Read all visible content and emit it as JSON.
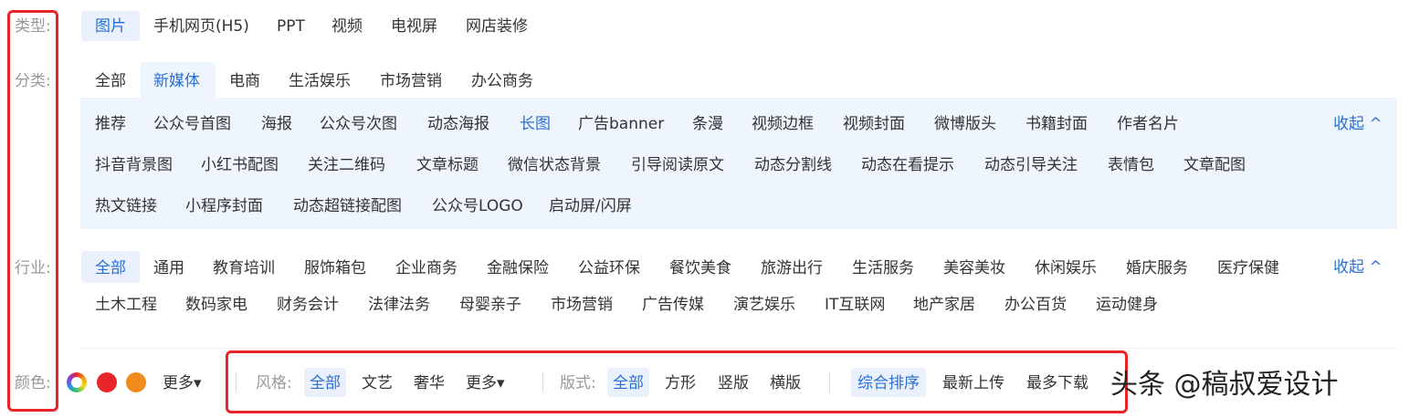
{
  "type_row": {
    "label": "类型:",
    "options": [
      "图片",
      "手机网页(H5)",
      "PPT",
      "视频",
      "电视屏",
      "网店装修"
    ]
  },
  "category_row": {
    "label": "分类:",
    "options": [
      "全部",
      "新媒体",
      "电商",
      "生活娱乐",
      "市场营销",
      "办公商务"
    ],
    "collapse_label": "收起 ^",
    "sub_rows": [
      [
        "推荐",
        "公众号首图",
        "海报",
        "公众号次图",
        "动态海报",
        "长图",
        "广告banner",
        "条漫",
        "视频边框",
        "视频封面",
        "微博版头",
        "书籍封面",
        "作者名片"
      ],
      [
        "抖音背景图",
        "小红书配图",
        "关注二维码",
        "文章标题",
        "微信状态背景",
        "引导阅读原文",
        "动态分割线",
        "动态在看提示",
        "动态引导关注",
        "表情包",
        "文章配图"
      ],
      [
        "热文链接",
        "小程序封面",
        "动态超链接配图",
        "公众号LOGO",
        "启动屏/闪屏"
      ]
    ]
  },
  "industry_row": {
    "label": "行业:",
    "collapse_label": "收起 ^",
    "rows": [
      [
        "全部",
        "通用",
        "教育培训",
        "服饰箱包",
        "企业商务",
        "金融保险",
        "公益环保",
        "餐饮美食",
        "旅游出行",
        "生活服务",
        "美容美妆",
        "休闲娱乐",
        "婚庆服务",
        "医疗保健"
      ],
      [
        "土木工程",
        "数码家电",
        "财务会计",
        "法律法务",
        "母婴亲子",
        "市场营销",
        "广告传媒",
        "演艺娱乐",
        "IT互联网",
        "地产家居",
        "办公百货",
        "运动健身"
      ]
    ]
  },
  "color_row": {
    "label": "颜色:",
    "swatch_colors": [
      "#e8262a",
      "#f08c1e"
    ],
    "more_label": "更多▾"
  },
  "style_group": {
    "label": "风格:",
    "options": [
      "全部",
      "文艺",
      "奢华",
      "更多▾"
    ]
  },
  "layout_group": {
    "label": "版式:",
    "options": [
      "全部",
      "方形",
      "竖版",
      "横版"
    ]
  },
  "sort_group": {
    "options": [
      "综合排序",
      "最新上传",
      "最多下载"
    ]
  },
  "watermark": "头条 @稿叔爱设计",
  "colors": {
    "accent": "#2a6fd3",
    "active_bg": "#eaf1fc",
    "highlight_box": "#e8262a"
  }
}
